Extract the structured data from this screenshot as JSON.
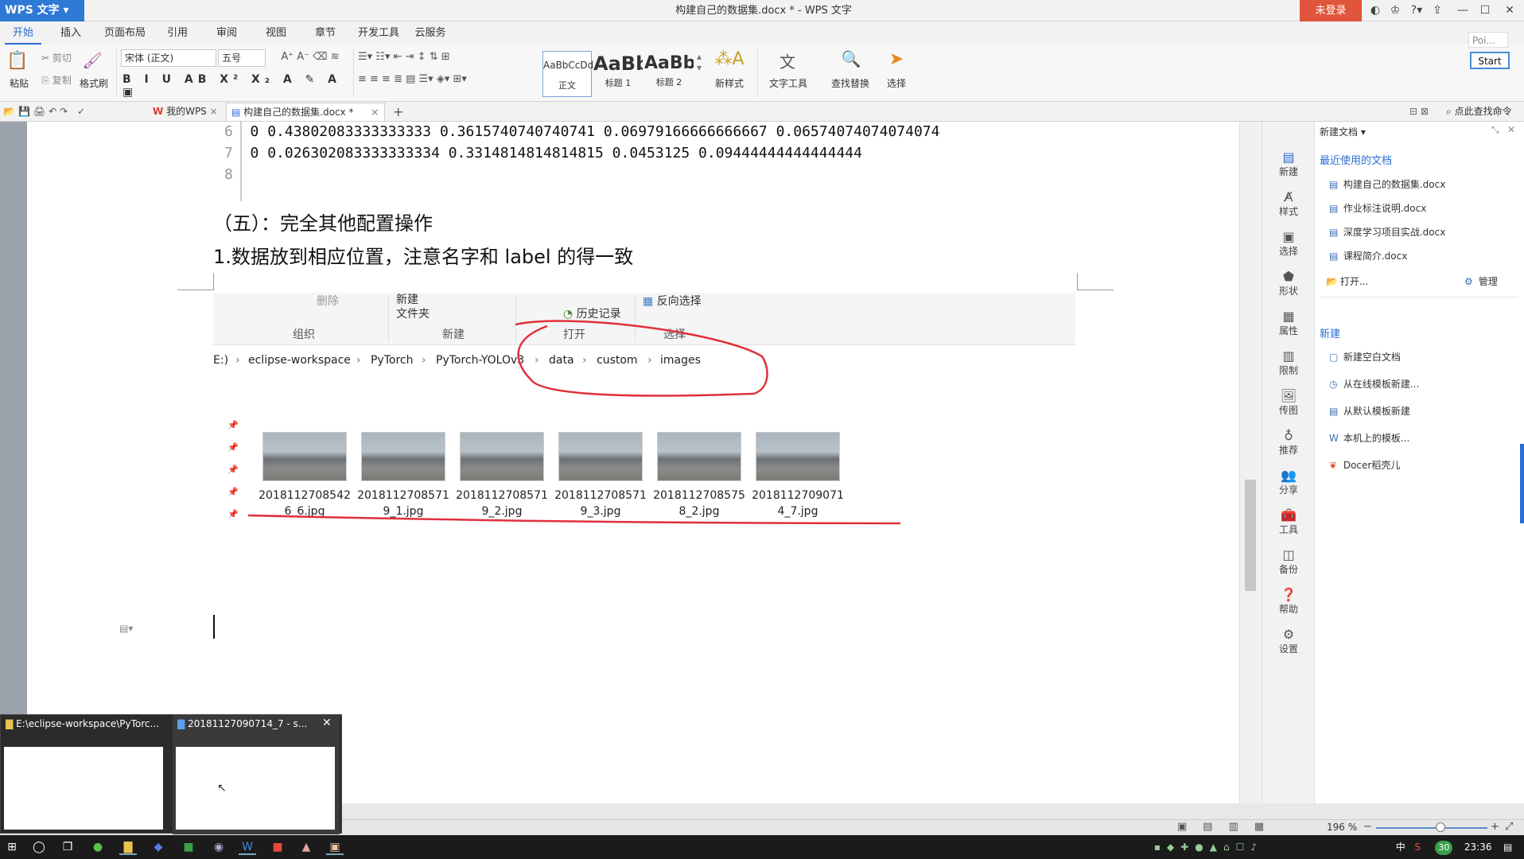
{
  "app": {
    "name": "WPS 文字",
    "window_title": "构建自己的数据集.docx * - WPS 文字",
    "login_label": "未登录"
  },
  "menu_tabs": [
    "开始",
    "插入",
    "页面布局",
    "引用",
    "审阅",
    "视图",
    "章节",
    "开发工具",
    "云服务"
  ],
  "ribbon": {
    "paste": "粘贴",
    "cut": "剪切",
    "copy": "复制",
    "format_painter": "格式刷",
    "font_name": "宋体 (正文)",
    "font_size": "五号",
    "styles": [
      {
        "preview": "AaBbCcDd",
        "name": "正文"
      },
      {
        "preview": "AaBb",
        "name": "标题 1"
      },
      {
        "preview": "AaBb(",
        "name": "标题 2"
      }
    ],
    "new_style": "新样式",
    "text_tools": "文字工具",
    "find_replace": "查找替换",
    "select": "选择",
    "side_input": "Poi...",
    "start_button": "Start"
  },
  "tabs": {
    "mywps": "我的WPS",
    "doc": "构建自己的数据集.docx *",
    "search_cmd": "点此查找命令"
  },
  "document": {
    "code_lines": [
      {
        "num": "6",
        "text": "0 0.43802083333333333 0.3615740740740741 0.06979166666666667 0.06574074074074074"
      },
      {
        "num": "7",
        "text": "0 0.026302083333333334 0.3314814814814815 0.0453125 0.09444444444444444"
      },
      {
        "num": "8",
        "text": ""
      }
    ],
    "heading": "（五）：完全其他配置操作",
    "body": "1.数据放到相应位置，注意名字和 label 的得一致"
  },
  "explorer": {
    "ribbon_groups": [
      "组织",
      "新建",
      "打开",
      "选择"
    ],
    "new_folder": "新建\n文件夹",
    "delete": "删除",
    "history": "历史记录",
    "invert_select": "反向选择",
    "path": [
      "E:)",
      "eclipse-workspace",
      "PyTorch",
      "PyTorch-YOLOv3",
      "data",
      "custom",
      "images"
    ],
    "files": [
      {
        "line1": "2018112708542",
        "line2": "6_6.jpg"
      },
      {
        "line1": "2018112708571",
        "line2": "9_1.jpg"
      },
      {
        "line1": "2018112708571",
        "line2": "9_2.jpg"
      },
      {
        "line1": "2018112708571",
        "line2": "9_3.jpg"
      },
      {
        "line1": "2018112708575",
        "line2": "8_2.jpg"
      },
      {
        "line1": "2018112709071",
        "line2": "4_7.jpg"
      }
    ]
  },
  "rail": [
    "新建",
    "样式",
    "选择",
    "形状",
    "属性",
    "限制",
    "传图",
    "推荐",
    "分享",
    "工具",
    "备份",
    "帮助",
    "设置"
  ],
  "panel": {
    "title": "新建文档",
    "recent_title": "最近使用的文档",
    "recent": [
      "构建自己的数据集.docx",
      "作业标注说明.docx",
      "深度学习项目实战.docx",
      "课程简介.docx"
    ],
    "open": "打开...",
    "manage": "管理",
    "new_title": "新建",
    "new_items": [
      "新建空白文档",
      "从在线模板新建...",
      "从默认模板新建",
      "本机上的模板...",
      "Docer稻壳儿"
    ]
  },
  "status": {
    "zoom": "196 %"
  },
  "popup": [
    {
      "title": "E:\\eclipse-workspace\\PyTorc..."
    },
    {
      "title": "20181127090714_7 - s..."
    }
  ],
  "taskbar": {
    "time": "23:36",
    "ime": "中",
    "badge": "30"
  },
  "colors": {
    "accent": "#2a6ed4",
    "login": "#e0553b",
    "annotation": "#e0303a"
  }
}
